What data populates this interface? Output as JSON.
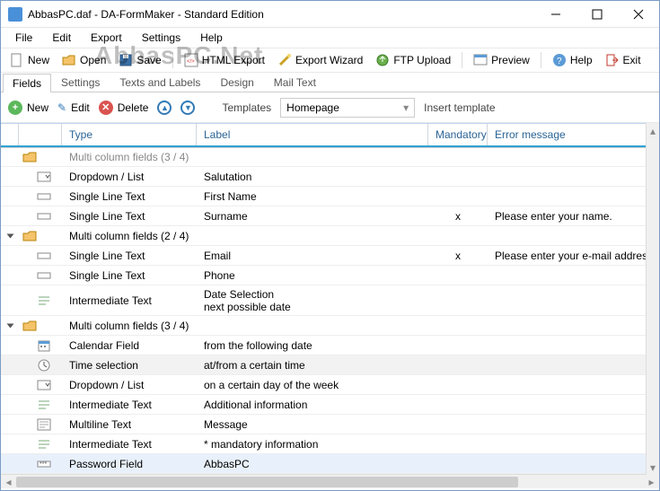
{
  "window": {
    "title": "AbbasPC.daf - DA-FormMaker  - Standard Edition"
  },
  "menu": {
    "file": "File",
    "edit": "Edit",
    "export": "Export",
    "settings": "Settings",
    "help": "Help"
  },
  "toolbar": {
    "new": "New",
    "open": "Open",
    "save": "Save",
    "html_export": "HTML Export",
    "export_wizard": "Export Wizard",
    "ftp_upload": "FTP Upload",
    "preview": "Preview",
    "help": "Help",
    "exit": "Exit"
  },
  "watermark": "AbbasPC.Net",
  "tabs": {
    "fields": "Fields",
    "settings": "Settings",
    "texts_labels": "Texts and Labels",
    "design": "Design",
    "mail_text": "Mail Text"
  },
  "cmd": {
    "new": "New",
    "edit": "Edit",
    "delete": "Delete",
    "templates_label": "Templates",
    "template_selected": "Homepage",
    "insert_template": "Insert template"
  },
  "columns": {
    "type": "Type",
    "label": "Label",
    "mandatory": "Mandatory",
    "error": "Error message"
  },
  "rows": [
    {
      "kind": "group-partial",
      "type": "Multi column fields (3 / 4)"
    },
    {
      "kind": "item",
      "icon": "dropdown",
      "type": "Dropdown / List",
      "label": "Salutation"
    },
    {
      "kind": "item",
      "icon": "text",
      "type": "Single Line Text",
      "label": "First Name"
    },
    {
      "kind": "item",
      "icon": "text",
      "type": "Single Line Text",
      "label": "Surname",
      "mand": "x",
      "err": "Please enter your name."
    },
    {
      "kind": "group",
      "open": true,
      "type": "Multi column fields (2 / 4)"
    },
    {
      "kind": "item",
      "icon": "text",
      "type": "Single Line Text",
      "label": "Email",
      "mand": "x",
      "err": "Please enter your e-mail address so"
    },
    {
      "kind": "item",
      "icon": "text",
      "type": "Single Line Text",
      "label": "Phone"
    },
    {
      "kind": "item-tall",
      "icon": "inter",
      "type": "Intermediate Text",
      "label": "Date Selection\nnext possible date"
    },
    {
      "kind": "group",
      "open": true,
      "type": "Multi column fields (3 / 4)"
    },
    {
      "kind": "item",
      "icon": "calendar",
      "type": "Calendar Field",
      "label": "from the following date"
    },
    {
      "kind": "item",
      "icon": "clock",
      "hl": "hov",
      "type": "Time selection",
      "label": "at/from a certain time"
    },
    {
      "kind": "item",
      "icon": "dropdown",
      "type": "Dropdown / List",
      "label": "on a certain day of the week"
    },
    {
      "kind": "item",
      "icon": "inter",
      "type": "Intermediate Text",
      "label": "Additional information"
    },
    {
      "kind": "item",
      "icon": "multi",
      "type": "Multiline Text",
      "label": "Message"
    },
    {
      "kind": "item",
      "icon": "inter",
      "type": "Intermediate Text",
      "label": "* mandatory information"
    },
    {
      "kind": "item",
      "icon": "password",
      "hl": "sel",
      "type": "Password Field",
      "label": "AbbasPC"
    }
  ]
}
